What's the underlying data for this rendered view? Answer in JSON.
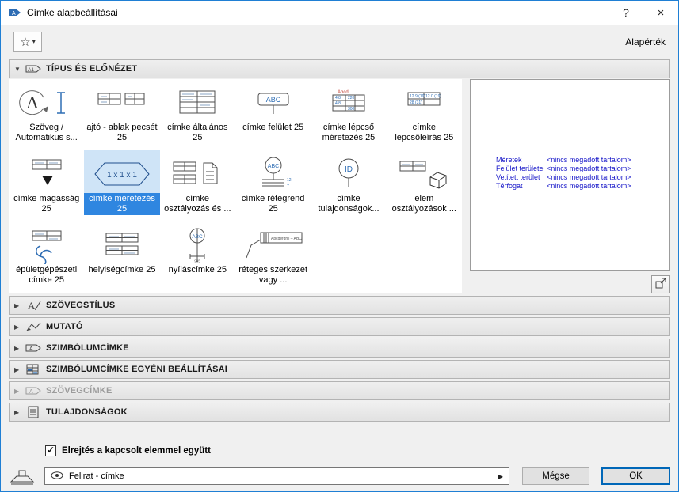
{
  "window": {
    "title": "Címke alapbeállításai",
    "help": "?",
    "close": "×"
  },
  "header": {
    "default_label": "Alapérték"
  },
  "icons": {
    "star": "☆",
    "star_arrow": "▾",
    "expanded": "▼",
    "collapsed": "▶",
    "check": "✓",
    "flyout_arrow": "▶"
  },
  "sections": [
    {
      "label": "TÍPUS ÉS ELŐNÉZET",
      "expanded": true,
      "icon": "tag-a1-icon"
    },
    {
      "label": "SZÖVEGSTÍLUS",
      "expanded": false,
      "icon": "text-style-icon"
    },
    {
      "label": "MUTATÓ",
      "expanded": false,
      "icon": "pointer-line-icon"
    },
    {
      "label": "SZIMBÓLUMCÍMKE",
      "expanded": false,
      "icon": "symbol-label-icon"
    },
    {
      "label": "SZIMBÓLUMCÍMKE EGYÉNI BEÁLLÍTÁSAI",
      "expanded": false,
      "icon": "custom-settings-grid-icon"
    },
    {
      "label": "SZÖVEGCÍMKE",
      "expanded": false,
      "disabled": true,
      "icon": "text-label-icon"
    },
    {
      "label": "TULAJDONSÁGOK",
      "expanded": false,
      "icon": "properties-list-icon"
    }
  ],
  "grid": {
    "selected_index": 7,
    "selected_label": "címke méretezés 25",
    "items": [
      {
        "label": "Szöveg / Automatikus s...",
        "icon": "text-autotext-icon"
      },
      {
        "label": "ajtó - ablak pecsét 25",
        "icon": "door-window-stamp-icon"
      },
      {
        "label": "címke általános 25",
        "icon": "label-general-icon"
      },
      {
        "label": "címke felület 25",
        "icon": "label-surface-icon"
      },
      {
        "label": "címke lépcső méretezés 25",
        "icon": "label-stair-dimension-icon"
      },
      {
        "label": "címke lépcsőleírás 25",
        "icon": "label-stair-description-icon"
      },
      {
        "label": "címke magasság 25",
        "icon": "label-height-icon"
      },
      {
        "label": "címke méretezés 25",
        "icon": "label-dimension-icon"
      },
      {
        "label": "címke osztályozás és ...",
        "icon": "label-classification-icon"
      },
      {
        "label": "címke rétegrend 25",
        "icon": "label-layer-order-icon"
      },
      {
        "label": "címke tulajdonságok...",
        "icon": "label-properties-icon"
      },
      {
        "label": "elem osztályozások ...",
        "icon": "element-classifications-icon"
      },
      {
        "label": "épületgépészeti címke 25",
        "icon": "mep-label-icon"
      },
      {
        "label": "helyiségcímke 25",
        "icon": "room-label-icon"
      },
      {
        "label": "nyíláscímke 25",
        "icon": "opening-label-icon"
      },
      {
        "label": "réteges szerkezet vagy ...",
        "icon": "composite-structure-label-icon"
      }
    ]
  },
  "preview": {
    "rows": [
      {
        "name": "Méretek",
        "value": "<nincs megadott tartalom>"
      },
      {
        "name": "Felület területe",
        "value": "<nincs megadott tartalom>"
      },
      {
        "name": "Vetített terület",
        "value": "<nincs megadott tartalom>"
      },
      {
        "name": "Térfogat",
        "value": "<nincs megadott tartalom>"
      }
    ]
  },
  "footer": {
    "checkbox_label": "Elrejtés a kapcsolt elemmel együtt",
    "checkbox_checked": true,
    "picker_value": "Felirat - címke",
    "cancel_label": "Mégse",
    "ok_label": "OK"
  }
}
